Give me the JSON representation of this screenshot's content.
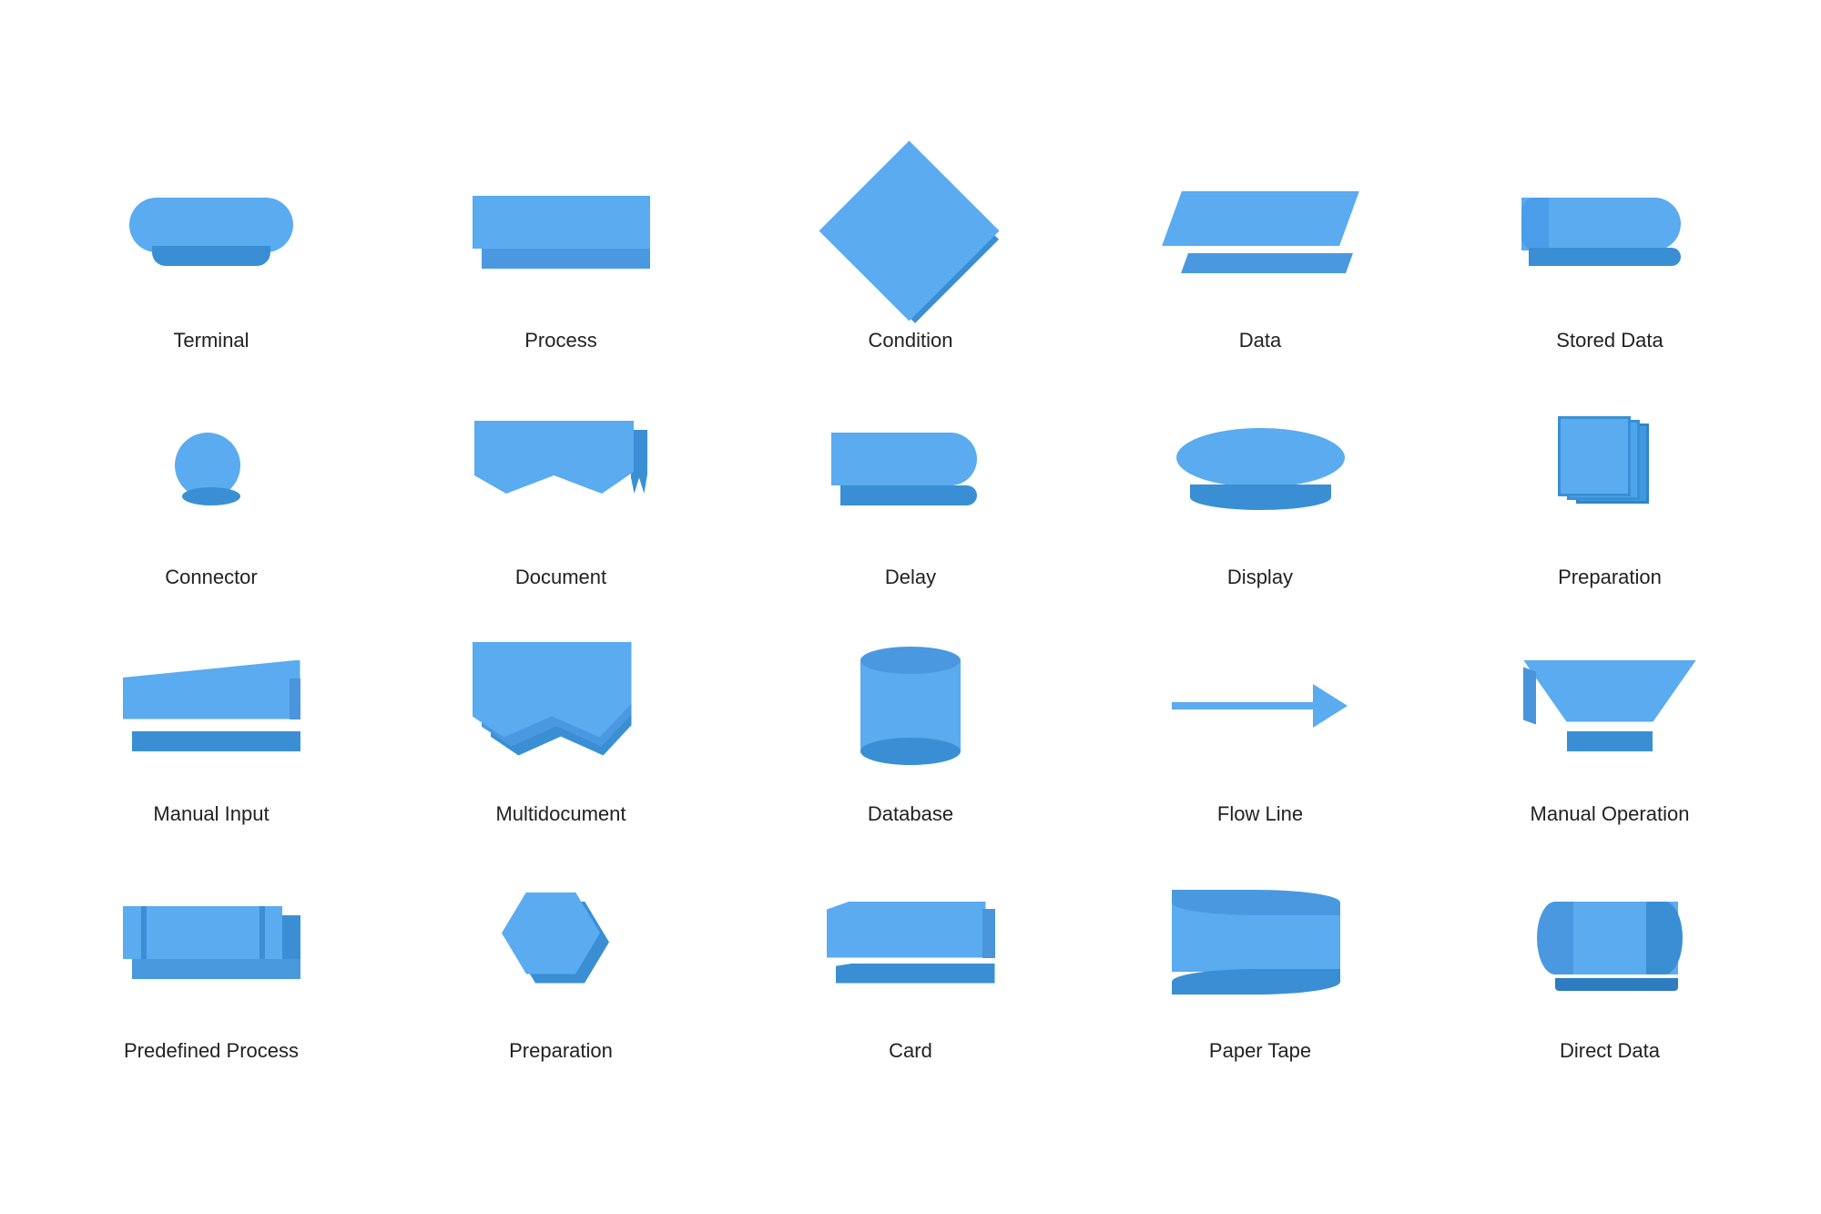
{
  "shapes": [
    {
      "id": "terminal",
      "label": "Terminal"
    },
    {
      "id": "process",
      "label": "Process"
    },
    {
      "id": "condition",
      "label": "Condition"
    },
    {
      "id": "data",
      "label": "Data"
    },
    {
      "id": "stored-data",
      "label": "Stored Data"
    },
    {
      "id": "connector",
      "label": "Connector"
    },
    {
      "id": "document",
      "label": "Document"
    },
    {
      "id": "delay",
      "label": "Delay"
    },
    {
      "id": "display",
      "label": "Display"
    },
    {
      "id": "preparation",
      "label": "Preparation"
    },
    {
      "id": "manual-input",
      "label": "Manual Input"
    },
    {
      "id": "multidocument",
      "label": "Multidocument"
    },
    {
      "id": "database",
      "label": "Database"
    },
    {
      "id": "flow-line",
      "label": "Flow Line"
    },
    {
      "id": "manual-operation",
      "label": "Manual Operation"
    },
    {
      "id": "predefined-process",
      "label": "Predefined Process"
    },
    {
      "id": "preparation2",
      "label": "Preparation"
    },
    {
      "id": "card",
      "label": "Card"
    },
    {
      "id": "paper-tape",
      "label": "Paper Tape"
    },
    {
      "id": "direct-data",
      "label": "Direct Data"
    }
  ]
}
